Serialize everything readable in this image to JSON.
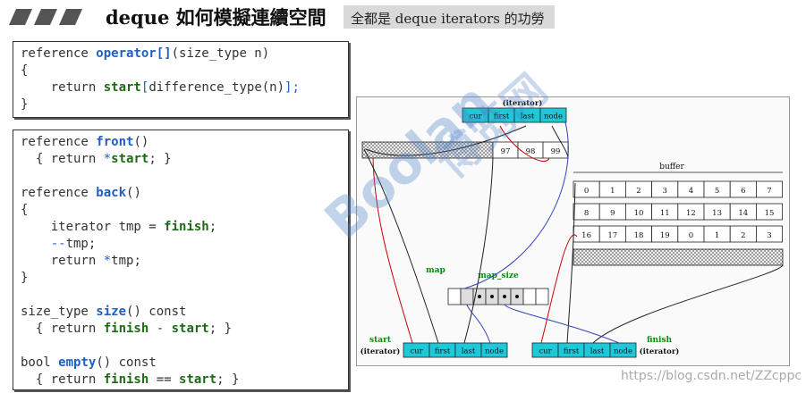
{
  "header": {
    "title": "deque 如何模擬連續空間",
    "subtitle": "全都是 deque iterators 的功勞"
  },
  "code_top": {
    "lines": [
      [
        {
          "t": "reference ",
          "c": ""
        },
        {
          "t": "operator[]",
          "c": "k"
        },
        {
          "t": "(size_type n)",
          "c": ""
        }
      ],
      [
        {
          "t": "{",
          "c": ""
        }
      ],
      [
        {
          "t": "    return ",
          "c": ""
        },
        {
          "t": "start",
          "c": "g"
        },
        {
          "t": "[",
          "c": "p"
        },
        {
          "t": "difference_type(n)",
          "c": ""
        },
        {
          "t": "];",
          "c": "p"
        }
      ],
      [
        {
          "t": "}",
          "c": ""
        }
      ]
    ]
  },
  "code_main": {
    "lines": [
      [
        {
          "t": "reference ",
          "c": ""
        },
        {
          "t": "front",
          "c": "k"
        },
        {
          "t": "()",
          "c": ""
        }
      ],
      [
        {
          "t": "  { return ",
          "c": ""
        },
        {
          "t": "*",
          "c": "p"
        },
        {
          "t": "start",
          "c": "g"
        },
        {
          "t": "; }",
          "c": ""
        }
      ],
      [],
      [
        {
          "t": "reference ",
          "c": ""
        },
        {
          "t": "back",
          "c": "k"
        },
        {
          "t": "()",
          "c": ""
        }
      ],
      [
        {
          "t": "{",
          "c": ""
        }
      ],
      [
        {
          "t": "    iterator tmp = ",
          "c": ""
        },
        {
          "t": "finish",
          "c": "g"
        },
        {
          "t": ";",
          "c": ""
        }
      ],
      [
        {
          "t": "    ",
          "c": ""
        },
        {
          "t": "--",
          "c": "p"
        },
        {
          "t": "tmp;",
          "c": ""
        }
      ],
      [
        {
          "t": "    return ",
          "c": ""
        },
        {
          "t": "*",
          "c": "p"
        },
        {
          "t": "tmp;",
          "c": ""
        }
      ],
      [
        {
          "t": "}",
          "c": ""
        }
      ],
      [],
      [
        {
          "t": "size_type ",
          "c": ""
        },
        {
          "t": "size",
          "c": "k"
        },
        {
          "t": "() const",
          "c": ""
        }
      ],
      [
        {
          "t": "  { return ",
          "c": ""
        },
        {
          "t": "finish",
          "c": "g"
        },
        {
          "t": " - ",
          "c": ""
        },
        {
          "t": "start",
          "c": "g"
        },
        {
          "t": "; }",
          "c": ""
        }
      ],
      [],
      [
        {
          "t": "bool ",
          "c": ""
        },
        {
          "t": "empty",
          "c": "k"
        },
        {
          "t": "() const",
          "c": ""
        }
      ],
      [
        {
          "t": "  { return ",
          "c": ""
        },
        {
          "t": "finish",
          "c": "g"
        },
        {
          "t": " == ",
          "c": ""
        },
        {
          "t": "start",
          "c": "g"
        },
        {
          "t": "; }",
          "c": ""
        }
      ]
    ]
  },
  "diagram": {
    "iterator_label": "(iterator)",
    "iterator_fields": [
      "cur",
      "first",
      "last",
      "node"
    ],
    "buffer_label": "buffer",
    "map_label": "map",
    "map_size_label": "map_size",
    "start_label": "start",
    "start_sub": "(iterator)",
    "finish_label": "finish",
    "finish_sub": "(iterator)",
    "top_buffer_values": [
      "97",
      "98",
      "99"
    ],
    "buffer_rows": [
      [
        "0",
        "1",
        "2",
        "3",
        "4",
        "5",
        "6",
        "7"
      ],
      [
        "8",
        "9",
        "10",
        "11",
        "12",
        "13",
        "14",
        "15"
      ],
      [
        "16",
        "17",
        "18",
        "19",
        "0",
        "1",
        "2",
        "3"
      ]
    ],
    "colors": {
      "iterator_fill": "#1ec8d8",
      "link_red": "#cc0000",
      "link_blue": "#3344bb",
      "link_black": "#222222",
      "label_green": "#118811"
    }
  },
  "watermark": {
    "text": "Boolan",
    "text_cn": "博览网"
  },
  "footer": {
    "credit": "https://blog.csdn.net/ZZcppc"
  }
}
